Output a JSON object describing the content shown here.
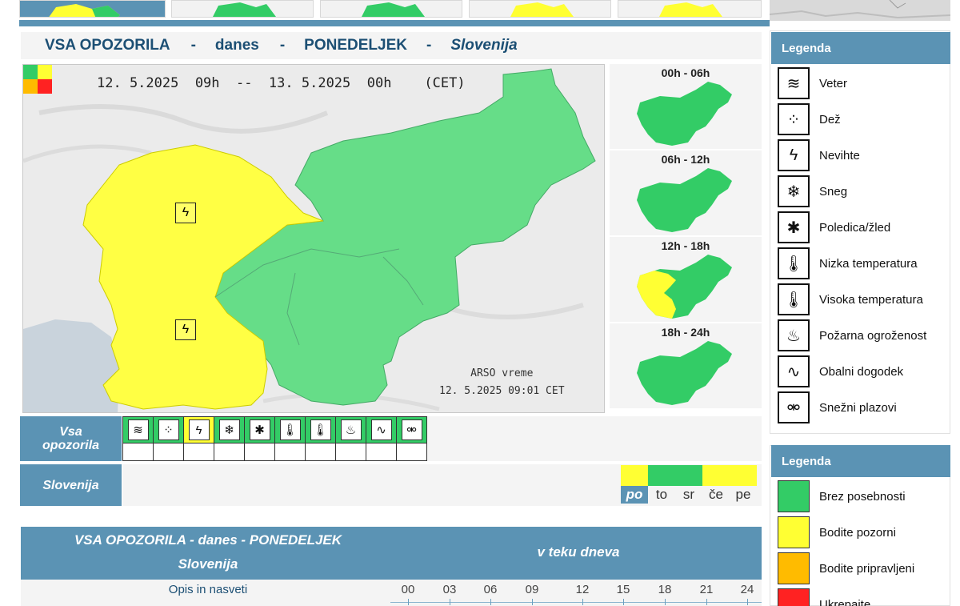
{
  "header": {
    "title": "VSA OPOZORILA",
    "sep1": "-",
    "when": "danes",
    "sep2": "-",
    "day": "PONEDELJEK",
    "sep3": "-",
    "region": "Slovenija"
  },
  "map": {
    "date_range": "12. 5.2025  09h  --  13. 5.2025  00h    (CET)",
    "credit_line1": "ARSO vreme",
    "credit_line2": "12. 5.2025  09:01 CET"
  },
  "time_slices": [
    {
      "label": "00h - 06h",
      "state": "green"
    },
    {
      "label": "06h - 12h",
      "state": "green"
    },
    {
      "label": "12h - 18h",
      "state": "mixed"
    },
    {
      "label": "18h - 24h",
      "state": "green"
    }
  ],
  "icon_row": {
    "label_line1": "Vsa",
    "label_line2": "opozorila",
    "icons": [
      {
        "name": "wind-icon",
        "glyph": "≋",
        "level": "green"
      },
      {
        "name": "rain-icon",
        "glyph": "⁘",
        "level": "green"
      },
      {
        "name": "thunderstorm-icon",
        "glyph": "ϟ",
        "level": "yellow"
      },
      {
        "name": "snow-icon",
        "glyph": "❄",
        "level": "green"
      },
      {
        "name": "ice-icon",
        "glyph": "✱",
        "level": "green"
      },
      {
        "name": "low-temperature-icon",
        "glyph": "🌡",
        "level": "green"
      },
      {
        "name": "high-temperature-icon",
        "glyph": "🌡",
        "level": "green"
      },
      {
        "name": "fire-danger-icon",
        "glyph": "♨",
        "level": "green"
      },
      {
        "name": "coastal-event-icon",
        "glyph": "∿",
        "level": "green"
      },
      {
        "name": "avalanche-icon",
        "glyph": "⚮",
        "level": "green"
      }
    ]
  },
  "region_row": {
    "label": "Slovenija",
    "days": [
      {
        "name": "po",
        "color": "#ffff33",
        "active": true
      },
      {
        "name": "to",
        "color": "#33cc66",
        "active": false
      },
      {
        "name": "sr",
        "color": "#33cc66",
        "active": false
      },
      {
        "name": "če",
        "color": "#ffff33",
        "active": false
      },
      {
        "name": "pe",
        "color": "#ffff33",
        "active": false
      }
    ]
  },
  "table": {
    "title_line1": "VSA OPOZORILA - danes - PONEDELJEK",
    "title_line2": "Slovenija",
    "time_header": "v teku dneva",
    "desc_header": "Opis in nasveti",
    "hours": [
      "00",
      "03",
      "06",
      "09",
      "12",
      "15",
      "18",
      "21",
      "24"
    ]
  },
  "legend_hazards": {
    "title": "Legenda",
    "items": [
      {
        "name": "wind-icon",
        "glyph": "≋",
        "label": "Veter"
      },
      {
        "name": "rain-icon",
        "glyph": "⁘",
        "label": "Dež"
      },
      {
        "name": "thunderstorm-icon",
        "glyph": "ϟ",
        "label": "Nevihte"
      },
      {
        "name": "snow-icon",
        "glyph": "❄",
        "label": "Sneg"
      },
      {
        "name": "ice-icon",
        "glyph": "✱",
        "label": "Poledica/žled"
      },
      {
        "name": "low-temperature-icon",
        "glyph": "🌡",
        "label": "Nizka temperatura"
      },
      {
        "name": "high-temperature-icon",
        "glyph": "🌡",
        "label": "Visoka temperatura"
      },
      {
        "name": "fire-danger-icon",
        "glyph": "♨",
        "label": "Požarna ogroženost"
      },
      {
        "name": "coastal-event-icon",
        "glyph": "∿",
        "label": "Obalni dogodek"
      },
      {
        "name": "avalanche-icon",
        "glyph": "⚮",
        "label": "Snežni plazovi"
      }
    ]
  },
  "legend_levels": {
    "title": "Legenda",
    "items": [
      {
        "color": "#33cc66",
        "label": "Brez posebnosti"
      },
      {
        "color": "#ffff33",
        "label": "Bodite pozorni"
      },
      {
        "color": "#ffbb00",
        "label": "Bodite pripravljeni"
      },
      {
        "color": "#ff2222",
        "label": "Ukrepajte"
      }
    ]
  },
  "colors": {
    "accent": "#5b93b4",
    "green": "#33cc66",
    "yellow": "#ffff33",
    "orange": "#ffbb00",
    "red": "#ff2222"
  }
}
